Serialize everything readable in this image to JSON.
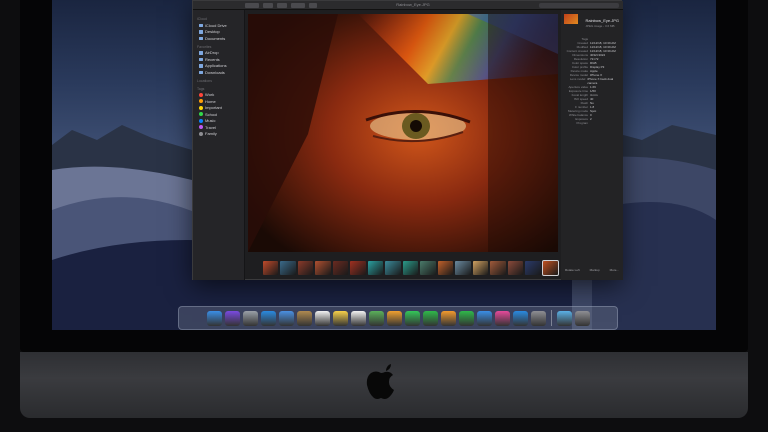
{
  "window": {
    "title": "Rainbow_Eye.JPG",
    "search_placeholder": "Search"
  },
  "sidebar": {
    "sections": [
      {
        "heading": "iCloud",
        "items": [
          {
            "label": "iCloud Drive",
            "icon": "cloud-icon"
          },
          {
            "label": "Desktop",
            "icon": "desktop-icon"
          },
          {
            "label": "Documents",
            "icon": "document-icon"
          }
        ]
      },
      {
        "heading": "Favorites",
        "items": [
          {
            "label": "AirDrop",
            "icon": "airdrop-icon"
          },
          {
            "label": "Recents",
            "icon": "clock-icon"
          },
          {
            "label": "Applications",
            "icon": "applications-icon"
          },
          {
            "label": "Downloads",
            "icon": "download-icon"
          }
        ]
      },
      {
        "heading": "Locations",
        "items": []
      },
      {
        "heading": "Tags",
        "items": [
          {
            "label": "Work",
            "color": "#ff453a"
          },
          {
            "label": "Home",
            "color": "#ff9f0a"
          },
          {
            "label": "Important",
            "color": "#ffd60a"
          },
          {
            "label": "School",
            "color": "#32d74b"
          },
          {
            "label": "Music",
            "color": "#0a84ff"
          },
          {
            "label": "Travel",
            "color": "#bf5af2"
          },
          {
            "label": "Family",
            "color": "#8e8e93"
          }
        ]
      }
    ]
  },
  "info_panel": {
    "title": "Rainbow_Eye.JPG",
    "subtitle": "JPEG image - 3.6 MB",
    "rows": [
      {
        "k": "Tags",
        "v": ""
      },
      {
        "k": "Created",
        "v": "11/12/18, 10:39 AM"
      },
      {
        "k": "Modified",
        "v": "11/12/18, 10:39 AM"
      },
      {
        "k": "Content created",
        "v": "11/12/18, 10:39 AM"
      },
      {
        "k": "Dimensions",
        "v": "4032×3024"
      },
      {
        "k": "Resolution",
        "v": "72×72"
      },
      {
        "k": "Color space",
        "v": "RGB"
      },
      {
        "k": "Color profile",
        "v": "Display P3"
      },
      {
        "k": "Device make",
        "v": "Apple"
      },
      {
        "k": "Device model",
        "v": "iPhone X"
      },
      {
        "k": "Lens model",
        "v": "iPhone X back dual camera"
      },
      {
        "k": "Aperture value",
        "v": "1.69"
      },
      {
        "k": "Exposure time",
        "v": "1/60"
      },
      {
        "k": "Focal length",
        "v": "4 mm"
      },
      {
        "k": "ISO speed",
        "v": "40"
      },
      {
        "k": "Flash",
        "v": "No"
      },
      {
        "k": "F number",
        "v": "1.8"
      },
      {
        "k": "Metering mode",
        "v": "Spot"
      },
      {
        "k": "White balance",
        "v": "0"
      },
      {
        "k": "Exposure Program",
        "v": "2"
      }
    ],
    "actions": [
      "Rotate Left",
      "Markup",
      "More..."
    ]
  },
  "filmstrip": {
    "count": 17,
    "selected_index": 16
  },
  "dock": {
    "apps": [
      {
        "name": "finder-icon",
        "color": "#3a8ee6"
      },
      {
        "name": "siri-icon",
        "color": "#7a4ae0"
      },
      {
        "name": "launchpad-icon",
        "color": "#9aa0a8"
      },
      {
        "name": "safari-icon",
        "color": "#2a8ae0"
      },
      {
        "name": "mail-icon",
        "color": "#4a90e2"
      },
      {
        "name": "contacts-icon",
        "color": "#b08a50"
      },
      {
        "name": "calendar-icon",
        "color": "#f2f2f2"
      },
      {
        "name": "notes-icon",
        "color": "#f7d04a"
      },
      {
        "name": "reminders-icon",
        "color": "#f2f2f2"
      },
      {
        "name": "maps-icon",
        "color": "#5ab05a"
      },
      {
        "name": "photos-icon",
        "color": "#f0a030"
      },
      {
        "name": "messages-icon",
        "color": "#34c759"
      },
      {
        "name": "facetime-icon",
        "color": "#2fb84a"
      },
      {
        "name": "pages-icon",
        "color": "#f29a2e"
      },
      {
        "name": "numbers-icon",
        "color": "#2fb84a"
      },
      {
        "name": "keynote-icon",
        "color": "#3a8ee6"
      },
      {
        "name": "itunes-icon",
        "color": "#e54a9a"
      },
      {
        "name": "app-store-icon",
        "color": "#2a8ae0"
      },
      {
        "name": "system-preferences-icon",
        "color": "#8e8e93"
      }
    ],
    "right": [
      {
        "name": "downloads-folder-icon",
        "color": "#5ab0e6"
      },
      {
        "name": "trash-icon",
        "color": "#8e8e93"
      }
    ]
  }
}
